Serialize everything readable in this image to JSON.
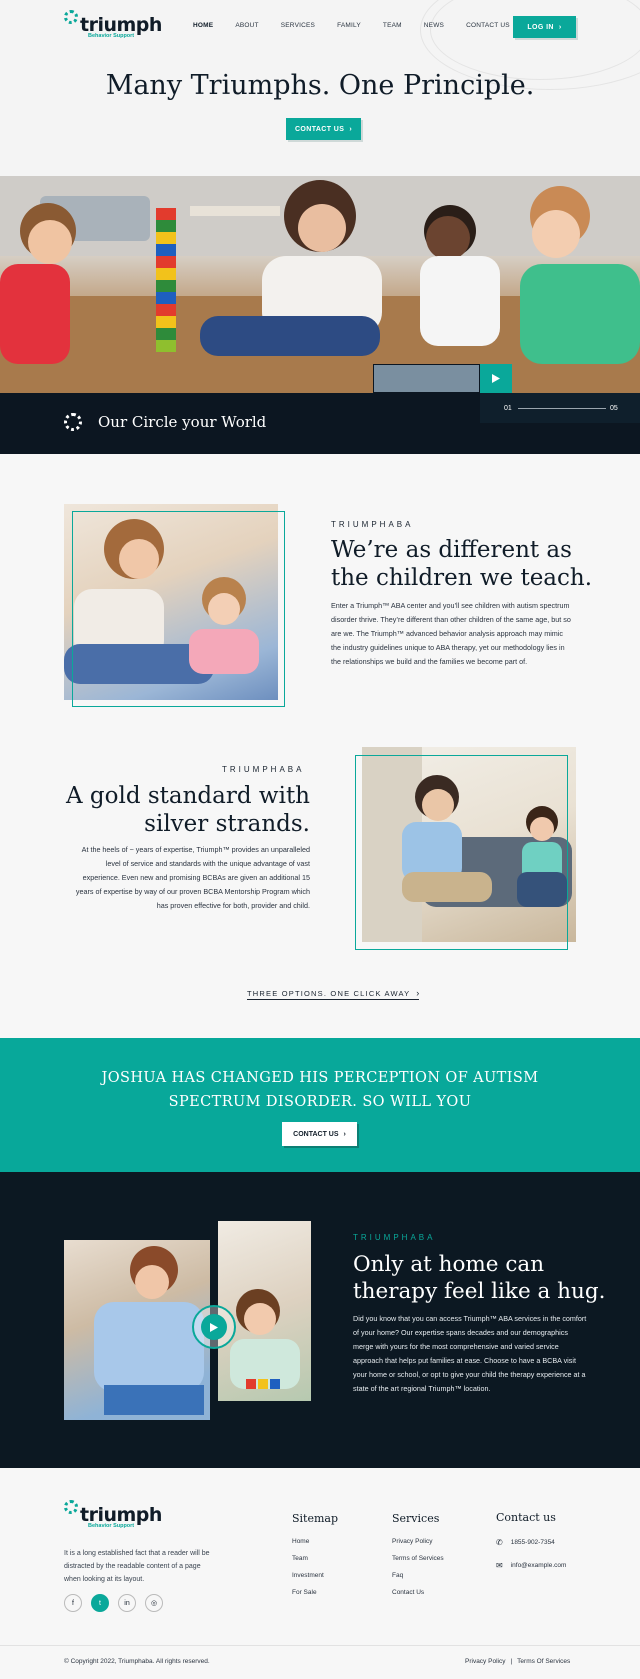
{
  "brand": {
    "name": "triumph",
    "tagline": "Behavior Support"
  },
  "nav": {
    "items": [
      "HOME",
      "ABOUT",
      "SERVICES",
      "FAMILY",
      "TEAM",
      "NEWS",
      "CONTACT US"
    ],
    "login_label": "LOG IN"
  },
  "hero": {
    "title": "Many Triumphs. One Principle.",
    "cta_label": "CONTACT US",
    "band_title": "Our Circle your World",
    "slide_current": "01",
    "slide_total": "05"
  },
  "section1": {
    "eyebrow": "TRIUMPHABA",
    "title_line1": "We’re as different as",
    "title_line2": "the children we teach.",
    "body": "Enter a Triumph™ ABA center and you’ll see children with autism spectrum disorder thrive. They’re different than other children of the same age, but so are we. The Triumph™ advanced behavior analysis approach may mimic the industry guidelines unique to ABA therapy, yet our methodology lies in the relationships we build and the families we become part of."
  },
  "section2": {
    "eyebrow": "TRIUMPHABA",
    "title_line1": "A gold standard with",
    "title_line2": "silver strands.",
    "body": "At the heels of ~ years of expertise, Triumph™ provides an unparalleled level of service and standards with the unique advantage of vast experience. Even new and promising BCBAs are given an additional 15 years of expertise by way of our proven BCBA Mentorship Program which has proven effective for both, provider and child.",
    "link_label": "THREE OPTIONS. ONE CLICK AWAY"
  },
  "cta_band": {
    "line1": "JOSHUA HAS CHANGED HIS PERCEPTION OF AUTISM",
    "line2": "SPECTRUM DISORDER. SO WILL YOU",
    "button_label": "CONTACT US"
  },
  "section3": {
    "eyebrow": "TRIUMPHABA",
    "title_line1": "Only at home can",
    "title_line2": "therapy feel like a hug.",
    "body": "Did you know that you can access Triumph™ ABA services in the comfort of your home? Our expertise spans decades and our demographics merge with yours for the most comprehensive and varied service approach that helps put families at ease. Choose to have a BCBA visit your home or school, or opt to give your child the therapy experience at a state of the art regional Triumph™ location."
  },
  "footer": {
    "about": "It is a long established fact that a reader will be distracted by the readable content of a page when looking at its layout.",
    "sitemap_title": "Sitemap",
    "sitemap": [
      "Home",
      "Team",
      "Investment",
      "For Sale"
    ],
    "services_title": "Services",
    "services": [
      "Privacy Policy",
      "Terms of Services",
      "Faq",
      "Contact Us"
    ],
    "contact_title": "Contact us",
    "phone": "1855-902-7354",
    "email": "info@example.com",
    "copyright": "© Copyright 2022, Triumphaba. All rights reserved.",
    "bottom_links": [
      "Privacy Policy",
      "Terms Of Services"
    ]
  },
  "colors": {
    "teal": "#0aa89a",
    "dark": "#0c1822"
  }
}
